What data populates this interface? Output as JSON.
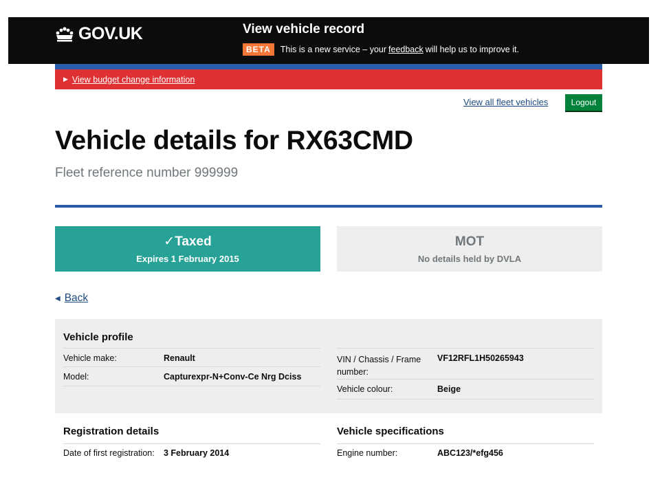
{
  "header": {
    "logo_text": "GOV.UK",
    "service_name": "View vehicle record",
    "phase_tag": "BETA",
    "phase_text_before": "This is a new service – your",
    "phase_link": "feedback",
    "phase_text_after": "will help us to improve it."
  },
  "banner": {
    "link": "View budget change information"
  },
  "nav": {
    "fleet_link": "View all fleet vehicles",
    "logout": "Logout"
  },
  "page": {
    "title": "Vehicle details for RX63CMD",
    "fleet_reference": "Fleet reference number 999999"
  },
  "status": {
    "tax_title": "✓Taxed",
    "tax_sub": "Expires 1 February 2015",
    "mot_title": "MOT",
    "mot_sub": "No details held by DVLA"
  },
  "back": "Back",
  "profile": {
    "heading": "Vehicle profile",
    "left": [
      {
        "label": "Vehicle make:",
        "value": "Renault"
      },
      {
        "label": "Model:",
        "value": "Capturexpr-N+Conv-Ce Nrg Dciss"
      }
    ],
    "right": [
      {
        "label": "VIN / Chassis / Frame number:",
        "value": "VF12RFL1H50265943"
      },
      {
        "label": "Vehicle colour:",
        "value": "Beige"
      }
    ]
  },
  "registration": {
    "heading": "Registration details",
    "rows": [
      {
        "label": "Date of first registration:",
        "value": "3 February 2014"
      }
    ]
  },
  "specifications": {
    "heading": "Vehicle specifications",
    "rows": [
      {
        "label": "Engine number:",
        "value": "ABC123/*efg456"
      }
    ]
  },
  "colors": {
    "header_bg": "#0b0c0c",
    "beta": "#f47738",
    "banner": "#df3034",
    "rule_blue": "#2b5ca8",
    "logout": "#00823b",
    "taxed": "#28a197",
    "panel": "#eeeeee"
  }
}
